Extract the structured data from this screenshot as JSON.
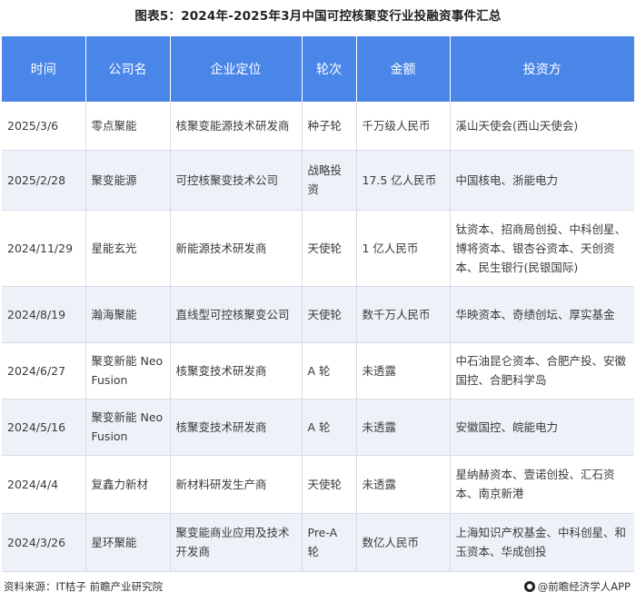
{
  "title": "图表5：2024年-2025年3月中国可控核聚变行业投融资事件汇总",
  "table": {
    "headers": [
      "时间",
      "公司名",
      "企业定位",
      "轮次",
      "金额",
      "投资方"
    ],
    "rows": [
      [
        "2025/3/6",
        "零点聚能",
        "核聚变能源技术研发商",
        "种子轮",
        "千万级人民币",
        "溪山天使会(西山天使会)"
      ],
      [
        "2025/2/28",
        "聚变能源",
        "可控核聚变技术公司",
        "战略投资",
        "17.5 亿人民币",
        "中国核电、浙能电力"
      ],
      [
        "2024/11/29",
        "星能玄光",
        "新能源技术研发商",
        "天使轮",
        "1 亿人民币",
        "钛资本、招商局创投、中科创星、博将资本、银杏谷资本、天创资本、民生银行(民银国际)"
      ],
      [
        "2024/8/19",
        "瀚海聚能",
        "直线型可控核聚变公司",
        "天使轮",
        "数千万人民币",
        "华映资本、奇绩创坛、厚实基金"
      ],
      [
        "2024/6/27",
        "聚变新能 Neo Fusion",
        "核聚变技术研发商",
        "A 轮",
        "未透露",
        "中石油昆仑资本、合肥产投、安徽国控、合肥科学岛"
      ],
      [
        "2024/5/16",
        "聚变新能 Neo Fusion",
        "核聚变技术研发商",
        "A 轮",
        "未透露",
        "安徽国控、皖能电力"
      ],
      [
        "2024/4/4",
        "复鑫力新材",
        "新材料研发生产商",
        "天使轮",
        "未透露",
        "星纳赫资本、壹诺创投、汇石资本、南京新港"
      ],
      [
        "2024/3/26",
        "星环聚能",
        "聚变能商业应用及技术开发商",
        "Pre-A 轮",
        "数亿人民币",
        "上海知识产权基金、中科创星、和玉资本、华成创投"
      ]
    ]
  },
  "footer": {
    "source": "资料来源：IT桔子 前瞻产业研究院",
    "brand": "@前瞻经济学人APP"
  }
}
